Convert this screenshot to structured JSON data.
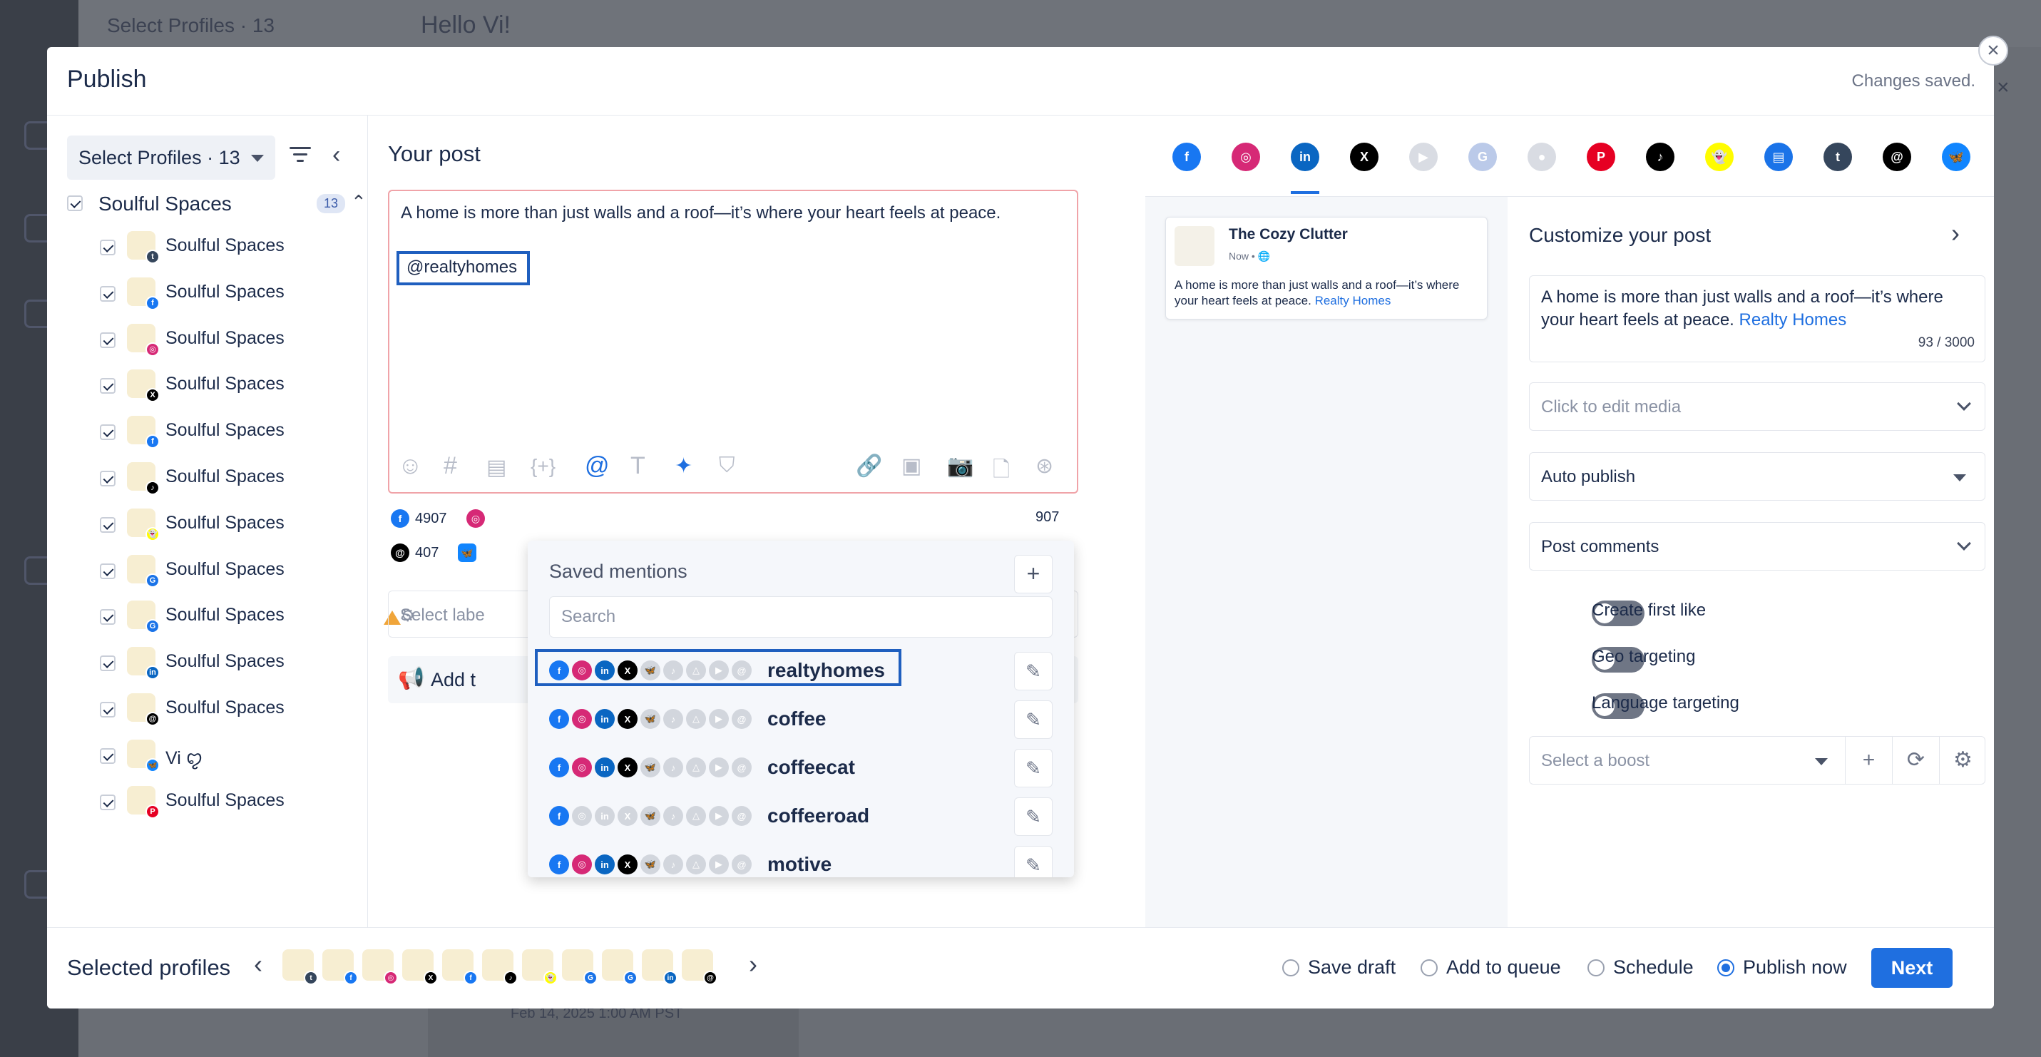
{
  "background": {
    "top_left_text": "Select Profiles · 13",
    "greeting": "Hello Vi!",
    "bottom_date": "Feb 14, 2025 1:00 AM PST"
  },
  "modal": {
    "title": "Publish",
    "status": "Changes saved."
  },
  "left": {
    "select_label": "Select Profiles · 13",
    "group_name": "Soulful Spaces",
    "group_count": "13",
    "profiles": [
      {
        "name": "Soulful Spaces",
        "network": "tumblr",
        "color": "#35465c",
        "glyph": "t"
      },
      {
        "name": "Soulful Spaces",
        "network": "facebook",
        "color": "#1877f2",
        "glyph": "f"
      },
      {
        "name": "Soulful Spaces",
        "network": "instagram",
        "color": "#d62976",
        "glyph": "◎"
      },
      {
        "name": "Soulful Spaces",
        "network": "x",
        "color": "#000000",
        "glyph": "X"
      },
      {
        "name": "Soulful Spaces",
        "network": "facebook",
        "color": "#1877f2",
        "glyph": "f"
      },
      {
        "name": "Soulful Spaces",
        "network": "tiktok",
        "color": "#000000",
        "glyph": "♪"
      },
      {
        "name": "Soulful Spaces",
        "network": "snapchat",
        "color": "#fffc00",
        "glyph": "👻"
      },
      {
        "name": "Soulful Spaces",
        "network": "google-business",
        "color": "#1a73e8",
        "glyph": "G"
      },
      {
        "name": "Soulful Spaces",
        "network": "google-business-warn",
        "color": "#1a73e8",
        "glyph": "G"
      },
      {
        "name": "Soulful Spaces",
        "network": "linkedin",
        "color": "#0a66c2",
        "glyph": "in"
      },
      {
        "name": "Soulful Spaces",
        "network": "threads",
        "color": "#000000",
        "glyph": "@"
      },
      {
        "name": "Vi ꨄ",
        "network": "bluesky",
        "color": "#1185fe",
        "glyph": "🦋"
      },
      {
        "name": "Soulful Spaces",
        "network": "pinterest",
        "color": "#e60023",
        "glyph": "P"
      }
    ]
  },
  "post": {
    "heading": "Your post",
    "text": "A home is more than just walls and a roof—it’s where your heart feels at peace.",
    "mention": "@realtyhomes",
    "counts": [
      {
        "network": "facebook",
        "value": "4907"
      },
      {
        "network": "instagram",
        "value": ""
      },
      {
        "network": "other",
        "value": "907"
      },
      {
        "network": "threads",
        "value": "407"
      },
      {
        "network": "bluesky",
        "value": ""
      }
    ],
    "label_placeholder": "Select labe",
    "add_label": "Add t"
  },
  "mentions": {
    "title": "Saved mentions",
    "search_placeholder": "Search",
    "items": [
      {
        "name": "realtyhomes",
        "active": [
          true,
          true,
          true,
          true,
          false,
          false,
          false,
          false,
          false
        ]
      },
      {
        "name": "coffee",
        "active": [
          true,
          true,
          true,
          true,
          false,
          false,
          false,
          false,
          false
        ]
      },
      {
        "name": "coffeecat",
        "active": [
          true,
          true,
          true,
          true,
          false,
          false,
          false,
          false,
          false
        ]
      },
      {
        "name": "coffeeroad",
        "active": [
          true,
          false,
          false,
          false,
          false,
          false,
          false,
          false,
          false
        ]
      },
      {
        "name": "motive",
        "active": [
          true,
          true,
          true,
          true,
          false,
          false,
          false,
          false,
          false
        ]
      }
    ]
  },
  "network_tabs": [
    {
      "name": "facebook",
      "color": "#1877f2",
      "glyph": "f",
      "dim": false
    },
    {
      "name": "instagram",
      "color": "#d62976",
      "glyph": "◎",
      "dim": false
    },
    {
      "name": "linkedin",
      "color": "#0a66c2",
      "glyph": "in",
      "dim": false,
      "active": true
    },
    {
      "name": "x",
      "color": "#000000",
      "glyph": "X",
      "dim": false
    },
    {
      "name": "youtube",
      "color": "#c9ced8",
      "glyph": "▶",
      "dim": true
    },
    {
      "name": "google-business",
      "color": "#9fb4e0",
      "glyph": "G",
      "dim": true
    },
    {
      "name": "reddit",
      "color": "#c9ced8",
      "glyph": "●",
      "dim": true
    },
    {
      "name": "pinterest",
      "color": "#e60023",
      "glyph": "P",
      "dim": false
    },
    {
      "name": "tiktok",
      "color": "#000000",
      "glyph": "♪",
      "dim": false
    },
    {
      "name": "snapchat",
      "color": "#fffc00",
      "glyph": "👻",
      "dim": false
    },
    {
      "name": "google-business-2",
      "color": "#1a73e8",
      "glyph": "▤",
      "dim": false
    },
    {
      "name": "tumblr",
      "color": "#35465c",
      "glyph": "t",
      "dim": false
    },
    {
      "name": "threads",
      "color": "#000000",
      "glyph": "@",
      "dim": false
    },
    {
      "name": "bluesky",
      "color": "#1185fe",
      "glyph": "🦋",
      "dim": false
    }
  ],
  "preview": {
    "name": "The Cozy Clutter",
    "sub": "Now •",
    "text": "A home is more than just walls and a roof—it’s where your heart feels at peace.",
    "link": "Realty Homes"
  },
  "customize": {
    "title": "Customize your post",
    "text": "A home is more than just walls and a roof—it’s where your heart feels at peace.",
    "link": "Realty Homes",
    "counter": "93 / 3000",
    "media": "Click to edit media",
    "publish_mode": "Auto publish",
    "comments": "Post comments",
    "toggles": [
      "Create first like",
      "Geo targeting",
      "Language targeting"
    ],
    "boost_placeholder": "Select a boost"
  },
  "footer": {
    "selected_label": "Selected profiles",
    "options": [
      "Save draft",
      "Add to queue",
      "Schedule",
      "Publish now"
    ],
    "selected_option": "Publish now",
    "next_label": "Next"
  }
}
